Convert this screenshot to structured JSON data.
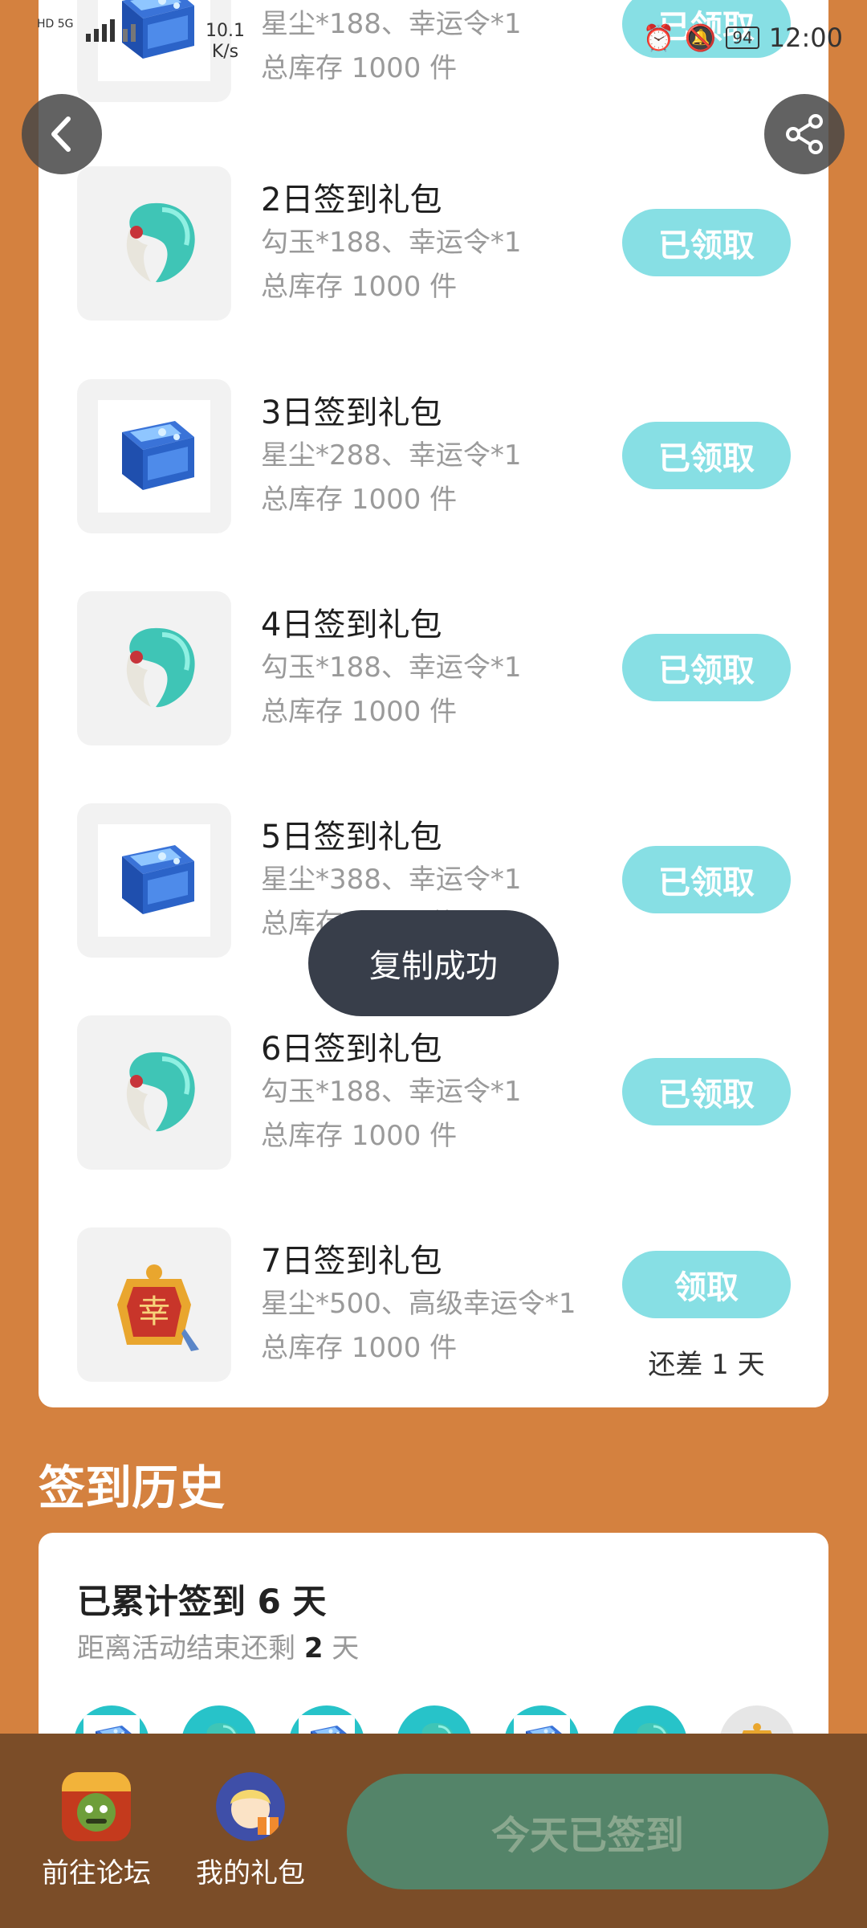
{
  "status_bar": {
    "network_left": "HD 5G",
    "speed_value": "10.1",
    "speed_unit": "K/s",
    "battery": "94",
    "time": "12:00"
  },
  "nav": {
    "back_icon": "chevron-left-icon",
    "share_icon": "share-icon"
  },
  "gifts": [
    {
      "title": "",
      "desc": "星尘*188、幸运令*1",
      "stock": "总库存 1000 件",
      "button": "已领取",
      "icon": "stardust-chest-icon"
    },
    {
      "title": "2日签到礼包",
      "desc": "勾玉*188、幸运令*1",
      "stock": "总库存 1000 件",
      "button": "已领取",
      "icon": "magatama-icon"
    },
    {
      "title": "3日签到礼包",
      "desc": "星尘*288、幸运令*1",
      "stock": "总库存 1000 件",
      "button": "已领取",
      "icon": "stardust-chest-icon"
    },
    {
      "title": "4日签到礼包",
      "desc": "勾玉*188、幸运令*1",
      "stock": "总库存 1000 件",
      "button": "已领取",
      "icon": "magatama-icon"
    },
    {
      "title": "5日签到礼包",
      "desc": "星尘*388、幸运令*1",
      "stock": "总库存 1000 件",
      "button": "已领取",
      "icon": "stardust-chest-icon"
    },
    {
      "title": "6日签到礼包",
      "desc": "勾玉*188、幸运令*1",
      "stock": "总库存 1000 件",
      "button": "已领取",
      "icon": "magatama-icon"
    },
    {
      "title": "7日签到礼包",
      "desc": "星尘*500、高级幸运令*1",
      "stock": "总库存 1000 件",
      "button": "领取",
      "remaining": "还差 1 天",
      "icon": "lucky-token-icon"
    }
  ],
  "toast": "复制成功",
  "history": {
    "section_title": "签到历史",
    "summary_prefix": "已累计签到 ",
    "summary_days": "6",
    "summary_suffix": " 天",
    "remaining_prefix": "距离活动结束还剩 ",
    "remaining_days": "2",
    "remaining_suffix": " 天",
    "days": [
      {
        "status": "signed",
        "icon": "stardust-chest-icon"
      },
      {
        "status": "signed",
        "icon": "magatama-icon"
      },
      {
        "status": "signed",
        "icon": "stardust-chest-icon"
      },
      {
        "status": "signed",
        "icon": "magatama-icon"
      },
      {
        "status": "signed",
        "icon": "stardust-chest-icon"
      },
      {
        "status": "signed",
        "icon": "magatama-icon"
      },
      {
        "status": "pending",
        "icon": "lucky-token-icon"
      }
    ]
  },
  "bottom_bar": {
    "forum_label": "前往论坛",
    "gifts_label": "我的礼包",
    "signin_label": "今天已签到"
  },
  "colors": {
    "background": "#D4813F",
    "claim_button": "#87DFE4",
    "bottom_bar": "#7B4D28",
    "signin_button": "#548469",
    "toast": "#383E4A"
  }
}
